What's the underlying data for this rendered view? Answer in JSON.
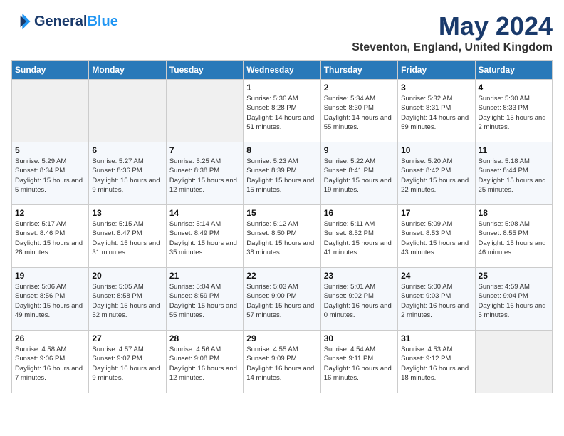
{
  "header": {
    "logo_general": "General",
    "logo_blue": "Blue",
    "month": "May 2024",
    "location": "Steventon, England, United Kingdom"
  },
  "days_of_week": [
    "Sunday",
    "Monday",
    "Tuesday",
    "Wednesday",
    "Thursday",
    "Friday",
    "Saturday"
  ],
  "weeks": [
    [
      {
        "day": "",
        "empty": true
      },
      {
        "day": "",
        "empty": true
      },
      {
        "day": "",
        "empty": true
      },
      {
        "day": "1",
        "sunrise": "5:36 AM",
        "sunset": "8:28 PM",
        "daylight": "14 hours and 51 minutes."
      },
      {
        "day": "2",
        "sunrise": "5:34 AM",
        "sunset": "8:30 PM",
        "daylight": "14 hours and 55 minutes."
      },
      {
        "day": "3",
        "sunrise": "5:32 AM",
        "sunset": "8:31 PM",
        "daylight": "14 hours and 59 minutes."
      },
      {
        "day": "4",
        "sunrise": "5:30 AM",
        "sunset": "8:33 PM",
        "daylight": "15 hours and 2 minutes."
      }
    ],
    [
      {
        "day": "5",
        "sunrise": "5:29 AM",
        "sunset": "8:34 PM",
        "daylight": "15 hours and 5 minutes."
      },
      {
        "day": "6",
        "sunrise": "5:27 AM",
        "sunset": "8:36 PM",
        "daylight": "15 hours and 9 minutes."
      },
      {
        "day": "7",
        "sunrise": "5:25 AM",
        "sunset": "8:38 PM",
        "daylight": "15 hours and 12 minutes."
      },
      {
        "day": "8",
        "sunrise": "5:23 AM",
        "sunset": "8:39 PM",
        "daylight": "15 hours and 15 minutes."
      },
      {
        "day": "9",
        "sunrise": "5:22 AM",
        "sunset": "8:41 PM",
        "daylight": "15 hours and 19 minutes."
      },
      {
        "day": "10",
        "sunrise": "5:20 AM",
        "sunset": "8:42 PM",
        "daylight": "15 hours and 22 minutes."
      },
      {
        "day": "11",
        "sunrise": "5:18 AM",
        "sunset": "8:44 PM",
        "daylight": "15 hours and 25 minutes."
      }
    ],
    [
      {
        "day": "12",
        "sunrise": "5:17 AM",
        "sunset": "8:46 PM",
        "daylight": "15 hours and 28 minutes."
      },
      {
        "day": "13",
        "sunrise": "5:15 AM",
        "sunset": "8:47 PM",
        "daylight": "15 hours and 31 minutes."
      },
      {
        "day": "14",
        "sunrise": "5:14 AM",
        "sunset": "8:49 PM",
        "daylight": "15 hours and 35 minutes."
      },
      {
        "day": "15",
        "sunrise": "5:12 AM",
        "sunset": "8:50 PM",
        "daylight": "15 hours and 38 minutes."
      },
      {
        "day": "16",
        "sunrise": "5:11 AM",
        "sunset": "8:52 PM",
        "daylight": "15 hours and 41 minutes."
      },
      {
        "day": "17",
        "sunrise": "5:09 AM",
        "sunset": "8:53 PM",
        "daylight": "15 hours and 43 minutes."
      },
      {
        "day": "18",
        "sunrise": "5:08 AM",
        "sunset": "8:55 PM",
        "daylight": "15 hours and 46 minutes."
      }
    ],
    [
      {
        "day": "19",
        "sunrise": "5:06 AM",
        "sunset": "8:56 PM",
        "daylight": "15 hours and 49 minutes."
      },
      {
        "day": "20",
        "sunrise": "5:05 AM",
        "sunset": "8:58 PM",
        "daylight": "15 hours and 52 minutes."
      },
      {
        "day": "21",
        "sunrise": "5:04 AM",
        "sunset": "8:59 PM",
        "daylight": "15 hours and 55 minutes."
      },
      {
        "day": "22",
        "sunrise": "5:03 AM",
        "sunset": "9:00 PM",
        "daylight": "15 hours and 57 minutes."
      },
      {
        "day": "23",
        "sunrise": "5:01 AM",
        "sunset": "9:02 PM",
        "daylight": "16 hours and 0 minutes."
      },
      {
        "day": "24",
        "sunrise": "5:00 AM",
        "sunset": "9:03 PM",
        "daylight": "16 hours and 2 minutes."
      },
      {
        "day": "25",
        "sunrise": "4:59 AM",
        "sunset": "9:04 PM",
        "daylight": "16 hours and 5 minutes."
      }
    ],
    [
      {
        "day": "26",
        "sunrise": "4:58 AM",
        "sunset": "9:06 PM",
        "daylight": "16 hours and 7 minutes."
      },
      {
        "day": "27",
        "sunrise": "4:57 AM",
        "sunset": "9:07 PM",
        "daylight": "16 hours and 9 minutes."
      },
      {
        "day": "28",
        "sunrise": "4:56 AM",
        "sunset": "9:08 PM",
        "daylight": "16 hours and 12 minutes."
      },
      {
        "day": "29",
        "sunrise": "4:55 AM",
        "sunset": "9:09 PM",
        "daylight": "16 hours and 14 minutes."
      },
      {
        "day": "30",
        "sunrise": "4:54 AM",
        "sunset": "9:11 PM",
        "daylight": "16 hours and 16 minutes."
      },
      {
        "day": "31",
        "sunrise": "4:53 AM",
        "sunset": "9:12 PM",
        "daylight": "16 hours and 18 minutes."
      },
      {
        "day": "",
        "empty": true
      }
    ]
  ]
}
